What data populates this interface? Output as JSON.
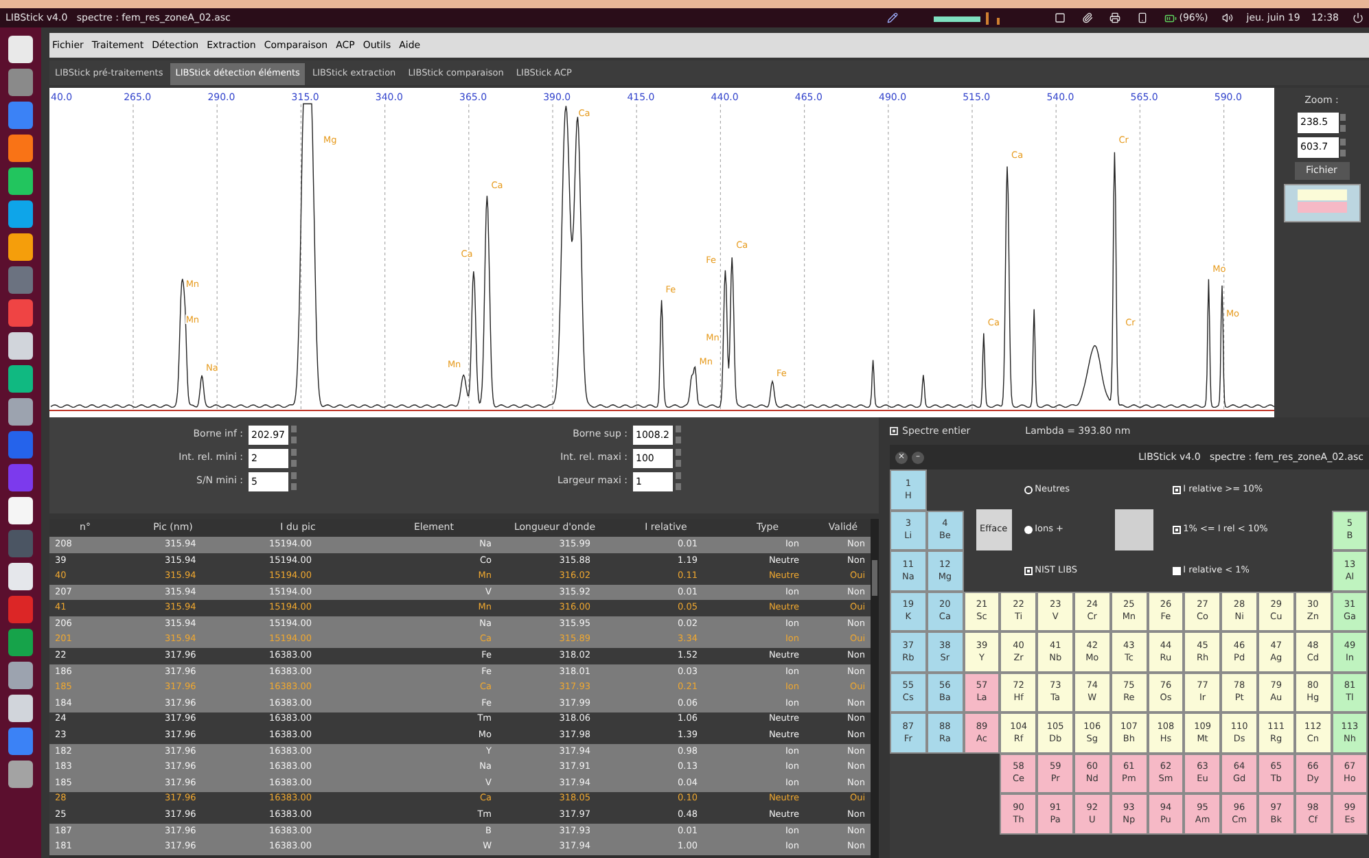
{
  "top_bar": {
    "title": "LIBStick v4.0   spectre : fem_res_zoneA_02.asc",
    "battery": "(96%)",
    "date": "jeu. juin 19",
    "time": "12:38"
  },
  "menu": [
    "Fichier",
    "Traitement",
    "Détection",
    "Extraction",
    "Comparaison",
    "ACP",
    "Outils",
    "Aide"
  ],
  "tabs": [
    {
      "label": "LIBStick pré-traitements",
      "selected": false
    },
    {
      "label": "LIBStick détection éléments",
      "selected": true
    },
    {
      "label": "LIBStick extraction",
      "selected": false
    },
    {
      "label": "LIBStick comparaison",
      "selected": false
    },
    {
      "label": "LIBStick ACP",
      "selected": false
    }
  ],
  "spectrum": {
    "axis_ticks": [
      "40.0",
      "265.0",
      "290.0",
      "315.0",
      "340.0",
      "365.0",
      "390.0",
      "415.0",
      "440.0",
      "465.0",
      "490.0",
      "515.0",
      "540.0",
      "565.0",
      "590.0"
    ],
    "peak_labels": [
      "Mn",
      "Mn",
      "Na",
      "Mg",
      "Mn",
      "Ca",
      "Ca",
      "Ca",
      "Fe",
      "Mn",
      "Fe",
      "Mn",
      "Ca",
      "Fe",
      "Ca",
      "Ca",
      "Cr",
      "Cr",
      "Mo",
      "Mo"
    ]
  },
  "zoom_panel": {
    "label": "Zoom :",
    "min": "238.5",
    "max": "603.7",
    "button": "Fichier"
  },
  "parameters": {
    "left": [
      {
        "label": "Borne inf :",
        "value": "202.97"
      },
      {
        "label": "Int. rel. mini :",
        "value": "2"
      },
      {
        "label": "S/N mini :",
        "value": "5"
      }
    ],
    "right": [
      {
        "label": "Borne sup :",
        "value": "1008.2"
      },
      {
        "label": "Int. rel. maxi :",
        "value": "100"
      },
      {
        "label": "Largeur maxi :",
        "value": "1"
      }
    ]
  },
  "spectre_entier": {
    "label": "Spectre entier",
    "checked": true
  },
  "lambda": "Lambda = 393.80 nm",
  "table": {
    "columns": [
      "n°",
      "Pic (nm)",
      "I du pic",
      "Element",
      "Longueur d'onde",
      "I relative",
      "Type",
      "Validé"
    ],
    "rows": [
      {
        "cells": [
          "208",
          "315.94",
          "15194.00",
          "Na",
          "315.99",
          "0.01",
          "Ion",
          "Non"
        ],
        "shaded": true,
        "highlighted": false
      },
      {
        "cells": [
          "39",
          "315.94",
          "15194.00",
          "Co",
          "315.88",
          "1.19",
          "Neutre",
          "Non"
        ],
        "shaded": false,
        "highlighted": false
      },
      {
        "cells": [
          "40",
          "315.94",
          "15194.00",
          "Mn",
          "316.02",
          "0.11",
          "Neutre",
          "Oui"
        ],
        "shaded": false,
        "highlighted": true
      },
      {
        "cells": [
          "207",
          "315.94",
          "15194.00",
          "V",
          "315.92",
          "0.01",
          "Ion",
          "Non"
        ],
        "shaded": true,
        "highlighted": false
      },
      {
        "cells": [
          "41",
          "315.94",
          "15194.00",
          "Mn",
          "316.00",
          "0.05",
          "Neutre",
          "Oui"
        ],
        "shaded": false,
        "highlighted": true
      },
      {
        "cells": [
          "206",
          "315.94",
          "15194.00",
          "Na",
          "315.95",
          "0.02",
          "Ion",
          "Non"
        ],
        "shaded": true,
        "highlighted": false
      },
      {
        "cells": [
          "201",
          "315.94",
          "15194.00",
          "Ca",
          "315.89",
          "3.34",
          "Ion",
          "Oui"
        ],
        "shaded": true,
        "highlighted": true
      },
      {
        "cells": [
          "22",
          "317.96",
          "16383.00",
          "Fe",
          "318.02",
          "1.52",
          "Neutre",
          "Non"
        ],
        "shaded": false,
        "highlighted": false
      },
      {
        "cells": [
          "186",
          "317.96",
          "16383.00",
          "Fe",
          "318.01",
          "0.03",
          "Ion",
          "Non"
        ],
        "shaded": true,
        "highlighted": false
      },
      {
        "cells": [
          "185",
          "317.96",
          "16383.00",
          "Ca",
          "317.93",
          "0.21",
          "Ion",
          "Oui"
        ],
        "shaded": true,
        "highlighted": true
      },
      {
        "cells": [
          "184",
          "317.96",
          "16383.00",
          "Fe",
          "317.99",
          "0.06",
          "Ion",
          "Non"
        ],
        "shaded": true,
        "highlighted": false
      },
      {
        "cells": [
          "24",
          "317.96",
          "16383.00",
          "Tm",
          "318.06",
          "1.06",
          "Neutre",
          "Non"
        ],
        "shaded": false,
        "highlighted": false
      },
      {
        "cells": [
          "23",
          "317.96",
          "16383.00",
          "Mo",
          "317.98",
          "1.39",
          "Neutre",
          "Non"
        ],
        "shaded": false,
        "highlighted": false
      },
      {
        "cells": [
          "182",
          "317.96",
          "16383.00",
          "Y",
          "317.94",
          "0.98",
          "Ion",
          "Non"
        ],
        "shaded": true,
        "highlighted": false
      },
      {
        "cells": [
          "183",
          "317.96",
          "16383.00",
          "Na",
          "317.91",
          "0.13",
          "Ion",
          "Non"
        ],
        "shaded": true,
        "highlighted": false
      },
      {
        "cells": [
          "185",
          "317.96",
          "16383.00",
          "V",
          "317.94",
          "0.04",
          "Ion",
          "Non"
        ],
        "shaded": true,
        "highlighted": false
      },
      {
        "cells": [
          "28",
          "317.96",
          "16383.00",
          "Ca",
          "318.05",
          "0.10",
          "Neutre",
          "Oui"
        ],
        "shaded": false,
        "highlighted": true
      },
      {
        "cells": [
          "25",
          "317.96",
          "16383.00",
          "Tm",
          "317.97",
          "0.48",
          "Neutre",
          "Non"
        ],
        "shaded": false,
        "highlighted": false
      },
      {
        "cells": [
          "187",
          "317.96",
          "16383.00",
          "B",
          "317.93",
          "0.01",
          "Ion",
          "Non"
        ],
        "shaded": true,
        "highlighted": false
      },
      {
        "cells": [
          "181",
          "317.96",
          "16383.00",
          "W",
          "317.94",
          "1.00",
          "Ion",
          "Non"
        ],
        "shaded": true,
        "highlighted": false
      }
    ]
  },
  "periodic_window": {
    "title": "LIBStick v4.0   spectre : fem_res_zoneA_02.asc",
    "close": "×",
    "minimize": "–",
    "efface": "Efface",
    "radios": [
      {
        "label": "Neutres",
        "selected": false
      },
      {
        "label": "Ions +",
        "selected": true
      }
    ],
    "nist": {
      "label": "NIST LIBS",
      "checked": true
    },
    "filters": [
      {
        "label": "I relative >= 10%",
        "checked": true
      },
      {
        "label": "1% <= I rel < 10%",
        "checked": true
      },
      {
        "label": "I relative < 1%",
        "checked": false
      }
    ],
    "rows": [
      [
        {
          "number": "1",
          "symbol": "H",
          "kind": "s"
        }
      ],
      [
        {
          "number": "3",
          "symbol": "Li",
          "kind": "s"
        },
        {
          "number": "4",
          "symbol": "Be",
          "kind": "s"
        },
        {
          "number": "5",
          "symbol": "B",
          "kind": "p"
        }
      ],
      [
        {
          "number": "11",
          "symbol": "Na",
          "kind": "s"
        },
        {
          "number": "12",
          "symbol": "Mg",
          "kind": "s"
        },
        {
          "number": "13",
          "symbol": "Al",
          "kind": "p"
        }
      ],
      [
        {
          "number": "19",
          "symbol": "K",
          "kind": "s"
        },
        {
          "number": "20",
          "symbol": "Ca",
          "kind": "s"
        },
        {
          "number": "21",
          "symbol": "Sc",
          "kind": "d"
        },
        {
          "number": "22",
          "symbol": "Ti",
          "kind": "d"
        },
        {
          "number": "23",
          "symbol": "V",
          "kind": "d"
        },
        {
          "number": "24",
          "symbol": "Cr",
          "kind": "d"
        },
        {
          "number": "25",
          "symbol": "Mn",
          "kind": "d"
        },
        {
          "number": "26",
          "symbol": "Fe",
          "kind": "d"
        },
        {
          "number": "27",
          "symbol": "Co",
          "kind": "d"
        },
        {
          "number": "28",
          "symbol": "Ni",
          "kind": "d"
        },
        {
          "number": "29",
          "symbol": "Cu",
          "kind": "d"
        },
        {
          "number": "30",
          "symbol": "Zn",
          "kind": "d"
        },
        {
          "number": "31",
          "symbol": "Ga",
          "kind": "p"
        }
      ],
      [
        {
          "number": "37",
          "symbol": "Rb",
          "kind": "s"
        },
        {
          "number": "38",
          "symbol": "Sr",
          "kind": "s"
        },
        {
          "number": "39",
          "symbol": "Y",
          "kind": "d"
        },
        {
          "number": "40",
          "symbol": "Zr",
          "kind": "d"
        },
        {
          "number": "41",
          "symbol": "Nb",
          "kind": "d"
        },
        {
          "number": "42",
          "symbol": "Mo",
          "kind": "d"
        },
        {
          "number": "43",
          "symbol": "Tc",
          "kind": "d"
        },
        {
          "number": "44",
          "symbol": "Ru",
          "kind": "d"
        },
        {
          "number": "45",
          "symbol": "Rh",
          "kind": "d"
        },
        {
          "number": "46",
          "symbol": "Pd",
          "kind": "d"
        },
        {
          "number": "47",
          "symbol": "Ag",
          "kind": "d"
        },
        {
          "number": "48",
          "symbol": "Cd",
          "kind": "d"
        },
        {
          "number": "49",
          "symbol": "In",
          "kind": "p"
        }
      ],
      [
        {
          "number": "55",
          "symbol": "Cs",
          "kind": "s"
        },
        {
          "number": "56",
          "symbol": "Ba",
          "kind": "s"
        },
        {
          "number": "57",
          "symbol": "La",
          "kind": "f"
        },
        {
          "number": "72",
          "symbol": "Hf",
          "kind": "d"
        },
        {
          "number": "73",
          "symbol": "Ta",
          "kind": "d"
        },
        {
          "number": "74",
          "symbol": "W",
          "kind": "d"
        },
        {
          "number": "75",
          "symbol": "Re",
          "kind": "d"
        },
        {
          "number": "76",
          "symbol": "Os",
          "kind": "d"
        },
        {
          "number": "77",
          "symbol": "Ir",
          "kind": "d"
        },
        {
          "number": "78",
          "symbol": "Pt",
          "kind": "d"
        },
        {
          "number": "79",
          "symbol": "Au",
          "kind": "d"
        },
        {
          "number": "80",
          "symbol": "Hg",
          "kind": "d"
        },
        {
          "number": "81",
          "symbol": "Tl",
          "kind": "p"
        }
      ],
      [
        {
          "number": "87",
          "symbol": "Fr",
          "kind": "s"
        },
        {
          "number": "88",
          "symbol": "Ra",
          "kind": "s"
        },
        {
          "number": "89",
          "symbol": "Ac",
          "kind": "f"
        },
        {
          "number": "104",
          "symbol": "Rf",
          "kind": "d"
        },
        {
          "number": "105",
          "symbol": "Db",
          "kind": "d"
        },
        {
          "number": "106",
          "symbol": "Sg",
          "kind": "d"
        },
        {
          "number": "107",
          "symbol": "Bh",
          "kind": "d"
        },
        {
          "number": "108",
          "symbol": "Hs",
          "kind": "d"
        },
        {
          "number": "109",
          "symbol": "Mt",
          "kind": "d"
        },
        {
          "number": "110",
          "symbol": "Ds",
          "kind": "d"
        },
        {
          "number": "111",
          "symbol": "Rg",
          "kind": "d"
        },
        {
          "number": "112",
          "symbol": "Cn",
          "kind": "d"
        },
        {
          "number": "113",
          "symbol": "Nh",
          "kind": "p"
        }
      ],
      [
        {
          "number": "58",
          "symbol": "Ce",
          "kind": "f"
        },
        {
          "number": "59",
          "symbol": "Pr",
          "kind": "f"
        },
        {
          "number": "60",
          "symbol": "Nd",
          "kind": "f"
        },
        {
          "number": "61",
          "symbol": "Pm",
          "kind": "f"
        },
        {
          "number": "62",
          "symbol": "Sm",
          "kind": "f"
        },
        {
          "number": "63",
          "symbol": "Eu",
          "kind": "f"
        },
        {
          "number": "64",
          "symbol": "Gd",
          "kind": "f"
        },
        {
          "number": "65",
          "symbol": "Tb",
          "kind": "f"
        },
        {
          "number": "66",
          "symbol": "Dy",
          "kind": "f"
        },
        {
          "number": "67",
          "symbol": "Ho",
          "kind": "f"
        }
      ],
      [
        {
          "number": "90",
          "symbol": "Th",
          "kind": "f"
        },
        {
          "number": "91",
          "symbol": "Pa",
          "kind": "f"
        },
        {
          "number": "92",
          "symbol": "U",
          "kind": "f"
        },
        {
          "number": "93",
          "symbol": "Np",
          "kind": "f"
        },
        {
          "number": "94",
          "symbol": "Pu",
          "kind": "f"
        },
        {
          "number": "95",
          "symbol": "Am",
          "kind": "f"
        },
        {
          "number": "96",
          "symbol": "Cm",
          "kind": "f"
        },
        {
          "number": "97",
          "symbol": "Bk",
          "kind": "f"
        },
        {
          "number": "98",
          "symbol": "Cf",
          "kind": "f"
        },
        {
          "number": "99",
          "symbol": "Es",
          "kind": "f"
        }
      ]
    ]
  }
}
